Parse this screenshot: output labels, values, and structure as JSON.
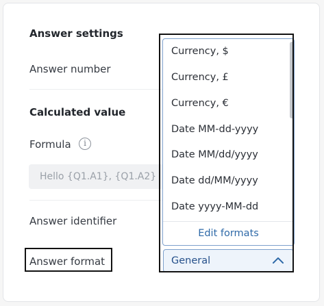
{
  "settings": {
    "section_title": "Answer settings",
    "answer_number_label": "Answer number",
    "calculated_value_label": "Calculated value",
    "formula_label": "Formula",
    "formula_info_glyph": "i",
    "formula_value": "Hello {Q1.A1}, {Q1.A2}",
    "answer_identifier_label": "Answer identifier",
    "answer_format_label": "Answer format"
  },
  "format_dropdown": {
    "options": [
      "Currency, $",
      "Currency, £",
      "Currency, €",
      "Date MM-dd-yyyy",
      "Date MM/dd/yyyy",
      "Date dd/MM/yyyy",
      "Date yyyy-MM-dd"
    ],
    "footer_link": "Edit formats",
    "selected_value": "General",
    "expanded": true
  },
  "colors": {
    "accent_border": "#7da0cc",
    "link": "#2f6aa8",
    "select_background": "#eef4fb",
    "highlight_outline": "#111111"
  },
  "icons": {
    "formula_help": "info-icon",
    "select_toggle": "chevron-up-icon"
  }
}
